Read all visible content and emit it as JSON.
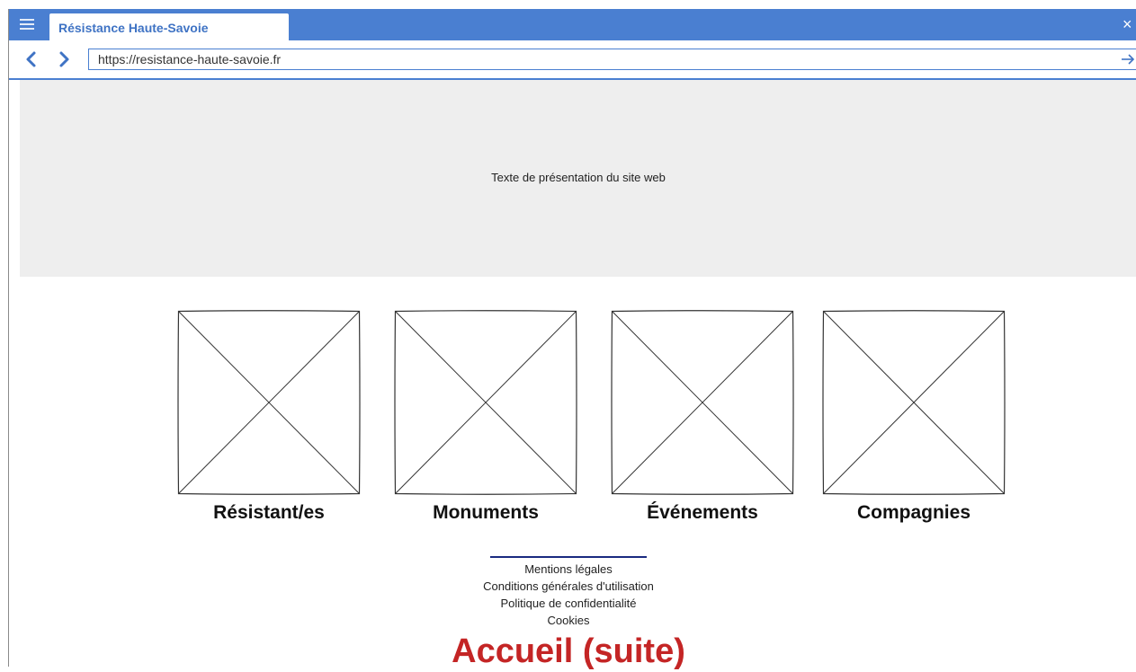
{
  "browser": {
    "tab_title": "Résistance Haute-Savoie",
    "url": "https://resistance-haute-savoie.fr",
    "accent_color": "#4a7fd1"
  },
  "icons": {
    "menu": "hamburger-menu-icon",
    "close": "close-icon",
    "back": "chevron-left-icon",
    "forward": "chevron-right-icon",
    "go": "arrow-right-icon",
    "image_placeholder": "image-placeholder-icon"
  },
  "hero": {
    "text": "Texte de présentation du site web"
  },
  "categories": [
    {
      "label": "Résistant/es"
    },
    {
      "label": "Monuments"
    },
    {
      "label": "Événements"
    },
    {
      "label": "Compagnies"
    }
  ],
  "footer": {
    "links": [
      "Mentions légales",
      "Conditions générales d'utilisation",
      "Politique de confidentialité",
      "Cookies"
    ]
  },
  "next_section": {
    "title": "Accueil (suite)",
    "color": "#c42525"
  }
}
